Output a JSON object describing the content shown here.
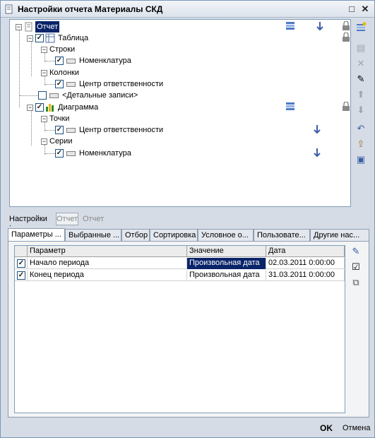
{
  "window": {
    "title": "Настройки отчета  Материалы СКД",
    "controls": {
      "restore": "□",
      "close": "✕"
    }
  },
  "tree": {
    "root": "Отчет",
    "nodes": {
      "table": "Таблица",
      "rows": "Строки",
      "rows_field": "Номенклатура",
      "columns": "Колонки",
      "columns_field": "Центр ответственности",
      "details": "<Детальные записи>",
      "chart": "Диаграмма",
      "points": "Точки",
      "points_field": "Центр ответственности",
      "series": "Серии",
      "series_field": "Номенклатура"
    },
    "checkmark": "✓"
  },
  "settings": {
    "label": "Настройки :",
    "button": "Отчет",
    "value": "Отчет"
  },
  "tabs": [
    "Параметры ...",
    "Выбранные ...",
    "Отбор",
    "Сортировка",
    "Условное о...",
    "Пользовате...",
    "Другие нас..."
  ],
  "params": {
    "columns": [
      "Параметр",
      "Значение",
      "Дата"
    ],
    "rows": [
      {
        "checked": "✓",
        "name": "Начало периода",
        "value": "Произвольная дата",
        "date": "02.03.2011 0:00:00"
      },
      {
        "checked": "✓",
        "name": "Конец периода",
        "value": "Произвольная дата",
        "date": "31.03.2011 0:00:00"
      }
    ]
  },
  "footer": {
    "ok": "OK",
    "cancel": "Отмена"
  }
}
